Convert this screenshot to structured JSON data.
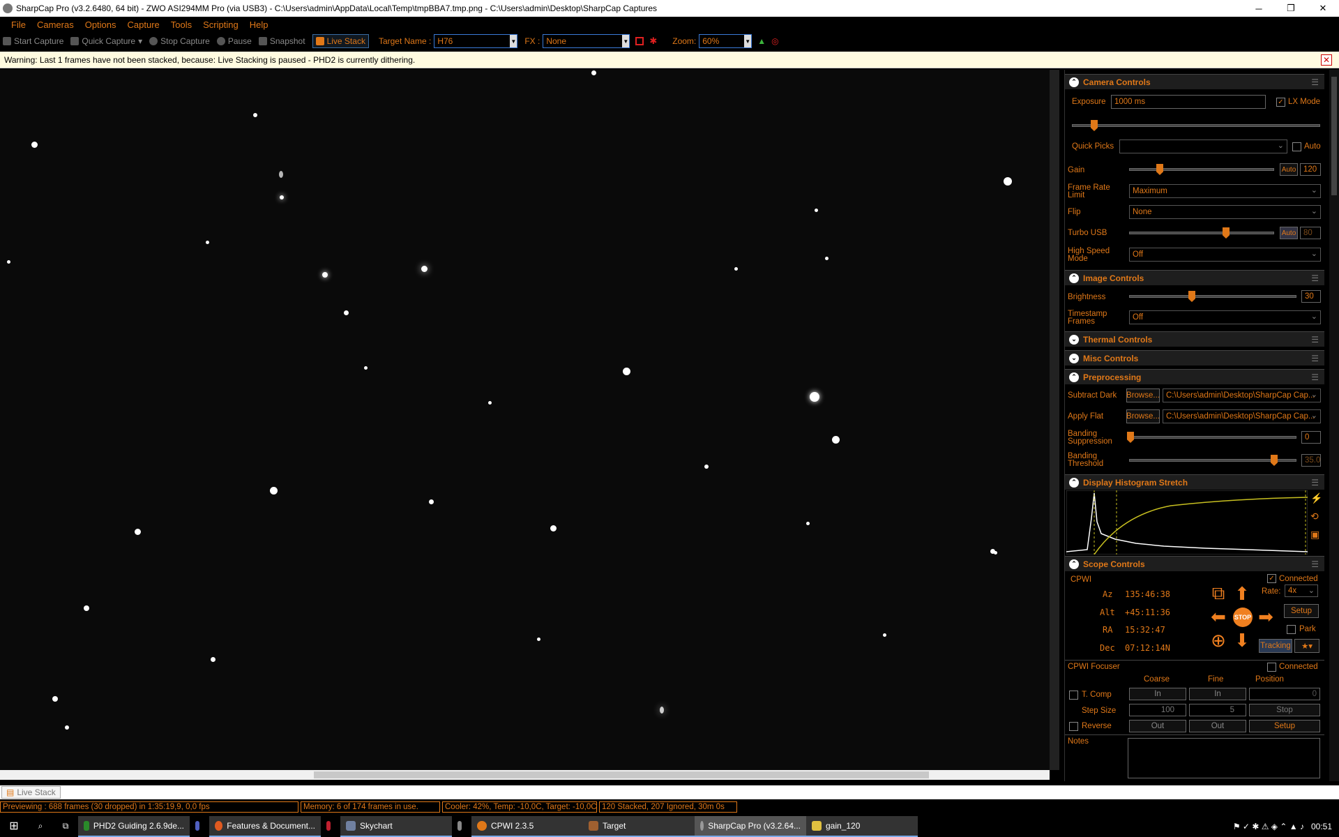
{
  "titlebar": {
    "title": "SharpCap Pro (v3.2.6480, 64 bit) - ZWO ASI294MM Pro (via USB3) - C:\\Users\\admin\\AppData\\Local\\Temp\\tmpBBA7.tmp.png - C:\\Users\\admin\\Desktop\\SharpCap Captures",
    "minimize": "─",
    "restore": "❐",
    "close": "✕"
  },
  "menu": [
    "File",
    "Cameras",
    "Options",
    "Capture",
    "Tools",
    "Scripting",
    "Help"
  ],
  "toolbar": {
    "start_capture": "Start Capture",
    "quick_capture": "Quick Capture",
    "stop_capture": "Stop Capture",
    "pause": "Pause",
    "snapshot": "Snapshot",
    "live_stack": "Live Stack",
    "target_label": "Target Name :",
    "target_value": "H76",
    "fx_label": "FX :",
    "fx_value": "None",
    "zoom_label": "Zoom:",
    "zoom_value": "60%"
  },
  "warning": {
    "text": "Warning: Last 1 frames have not been stacked, because: Live Stacking is paused - PHD2 is currently dithering.",
    "close": "✕"
  },
  "camera": {
    "title": "Camera Controls",
    "exposure_label": "Exposure",
    "exposure_value": "1000 ms",
    "lx_mode": "LX Mode",
    "quick_picks": "Quick Picks",
    "auto": "Auto",
    "gain_label": "Gain",
    "gain_auto": "Auto",
    "gain_value": "120",
    "frame_rate_label": "Frame Rate Limit",
    "frame_rate_value": "Maximum",
    "flip_label": "Flip",
    "flip_value": "None",
    "turbo_label": "Turbo USB",
    "turbo_auto": "Auto",
    "turbo_value": "80",
    "hsm_label": "High Speed Mode",
    "hsm_value": "Off"
  },
  "image": {
    "title": "Image Controls",
    "brightness_label": "Brightness",
    "brightness_value": "30",
    "timestamp_label": "Timestamp Frames",
    "timestamp_value": "Off"
  },
  "thermal": {
    "title": "Thermal Controls"
  },
  "misc": {
    "title": "Misc Controls"
  },
  "pre": {
    "title": "Preprocessing",
    "dark_label": "Subtract Dark",
    "flat_label": "Apply Flat",
    "browse": "Browse...",
    "dark_path": "C:\\Users\\admin\\Desktop\\SharpCap Cap...",
    "flat_path": "C:\\Users\\admin\\Desktop\\SharpCap Cap...",
    "band_sup_label": "Banding Suppression",
    "band_sup_value": "0",
    "band_thr_label": "Banding Threshold",
    "band_thr_value": "35.0"
  },
  "histo": {
    "title": "Display Histogram Stretch"
  },
  "scope": {
    "title": "Scope Controls",
    "mount": "CPWI",
    "connected": "Connected",
    "az_label": "Az",
    "az": "135:46:38",
    "alt_label": "Alt",
    "alt": "+45:11:36",
    "ra_label": "RA",
    "ra": "15:32:47",
    "dec_label": "Dec",
    "dec": "07:12:14N",
    "rate_label": "Rate:",
    "rate_value": "4x",
    "setup": "Setup",
    "park": "Park",
    "tracking": "Tracking",
    "stop": "STOP"
  },
  "focuser": {
    "title": "CPWI Focuser",
    "connected": "Connected",
    "coarse": "Coarse",
    "fine": "Fine",
    "position": "Position",
    "tcomp": "T. Comp",
    "in": "In",
    "position_value": "0",
    "step_size": "Step Size",
    "coarse_step": "100",
    "fine_step": "5",
    "stop": "Stop",
    "reverse": "Reverse",
    "out": "Out",
    "setup": "Setup"
  },
  "notes": {
    "label": "Notes"
  },
  "tab": {
    "label": "Live Stack"
  },
  "status": {
    "previewing": "Previewing : 688 frames (30 dropped) in 1:35:19,9, 0,0 fps",
    "memory": "Memory: 6 of 174 frames in use.",
    "cooler": "Cooler: 42%, Temp: -10,0C, Target: -10,0C",
    "stacked": "120 Stacked, 207 Ignored, 30m 0s"
  },
  "taskbar": {
    "items": [
      "PHD2 Guiding 2.6.9de...",
      "Features & Document...",
      "Skychart",
      "CPWI 2.3.5",
      "Target",
      "SharpCap Pro (v3.2.64...",
      "gain_120"
    ],
    "clock": "00:51"
  }
}
